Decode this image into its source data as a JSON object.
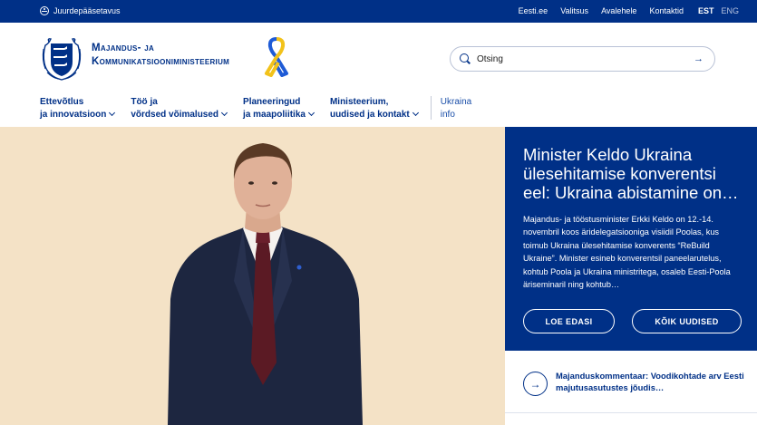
{
  "topbar": {
    "accessibility_label": "Juurdepääsetavus",
    "links": [
      "Eesti.ee",
      "Valitsus",
      "Avalehele",
      "Kontaktid"
    ],
    "languages": {
      "active": "EST",
      "other": "ENG"
    }
  },
  "header": {
    "ministry_line1": "Majandus- ja",
    "ministry_line2": "Kommunikatsiooniministeerium",
    "search_placeholder": "Otsing"
  },
  "nav": {
    "items": [
      {
        "line1": "Ettevõtlus",
        "line2": "ja innovatsioon"
      },
      {
        "line1": "Töö ja",
        "line2": "võrdsed võimalused"
      },
      {
        "line1": "Planeeringud",
        "line2": "ja maapoliitika"
      },
      {
        "line1": "Ministeerium,",
        "line2": "uudised ja kontakt"
      }
    ],
    "ukraina": {
      "line1": "Ukraina",
      "line2": "info"
    }
  },
  "featured": {
    "title": "Minister Keldo Ukraina ülesehitamise konverentsi eel: Ukraina abistamine on…",
    "body": "Majandus- ja tööstusminister Erkki Keldo on 12.-14. novembril koos äridelegatsiooniga visiidil Poolas, kus toimub Ukraina ülesehitamise konverents “ReBuild Ukraine”. Minister esineb konverentsil paneelarutelus, kohtub Poola ja Ukraina ministritega, osaleb Eesti-Poola äriseminaril ning kohtub…",
    "read_more": "LOE EDASI",
    "all_news": "KÕIK UUDISED"
  },
  "news_list": [
    {
      "title": "Majanduskommentaar: Voodikohtade arv Eesti majutusasutustes jõudis…"
    }
  ],
  "colors": {
    "brand_blue": "#003087",
    "hero_bg": "#f4e2c6"
  }
}
